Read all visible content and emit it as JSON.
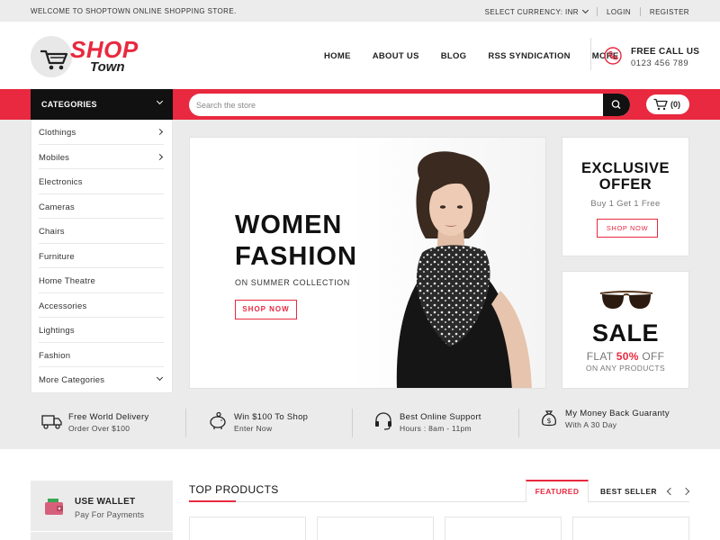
{
  "topbar": {
    "welcome": "WELCOME TO SHOPTOWN ONLINE SHOPPING STORE.",
    "currency": "SELECT CURRENCY: INR",
    "login": "LOGIN",
    "register": "REGISTER"
  },
  "logo": {
    "shop": "SHOP",
    "town": "Town"
  },
  "nav": [
    "HOME",
    "ABOUT US",
    "BLOG",
    "RSS SYNDICATION",
    "MORE"
  ],
  "call": {
    "title": "FREE CALL US",
    "number": "0123 456 789"
  },
  "categories": {
    "header": "CATEGORIES",
    "items": [
      "Clothings",
      "Mobiles",
      "Electronics",
      "Cameras",
      "Chairs",
      "Furniture",
      "Home Theatre",
      "Accessories",
      "Lightings",
      "Fashion"
    ],
    "more": "More Categories"
  },
  "search": {
    "placeholder": "Search the store"
  },
  "cart": {
    "count": "(0)"
  },
  "banner": {
    "line1": "WOMEN",
    "line2": "FASHION",
    "subtitle": "ON SUMMER COLLECTION",
    "button": "SHOP NOW"
  },
  "promo_exclusive": {
    "line1": "EXCLUSIVE",
    "line2": "OFFER",
    "subtitle": "Buy 1 Get 1 Free",
    "button": "SHOP NOW"
  },
  "promo_sale": {
    "title": "SALE",
    "flat": "FLAT",
    "percent": "50%",
    "off": "OFF",
    "subtitle": "ON ANY PRODUCTS"
  },
  "features": [
    {
      "title": "Free World Delivery",
      "sub": "Order Over $100"
    },
    {
      "title": "Win $100 To Shop",
      "sub": "Enter Now"
    },
    {
      "title": "Best Online Support",
      "sub": "Hours : 8am - 11pm"
    },
    {
      "title": "My Money Back Guaranty",
      "sub": "With A 30 Day"
    }
  ],
  "wallet": {
    "title": "USE WALLET",
    "sub": "Pay For Payments"
  },
  "top_products": {
    "title": "TOP PRODUCTS",
    "tabs": [
      "FEATURED",
      "BEST SELLER"
    ]
  },
  "colors": {
    "accent": "#e8293f",
    "dark": "#111111",
    "bg_gray": "#ebebeb"
  }
}
